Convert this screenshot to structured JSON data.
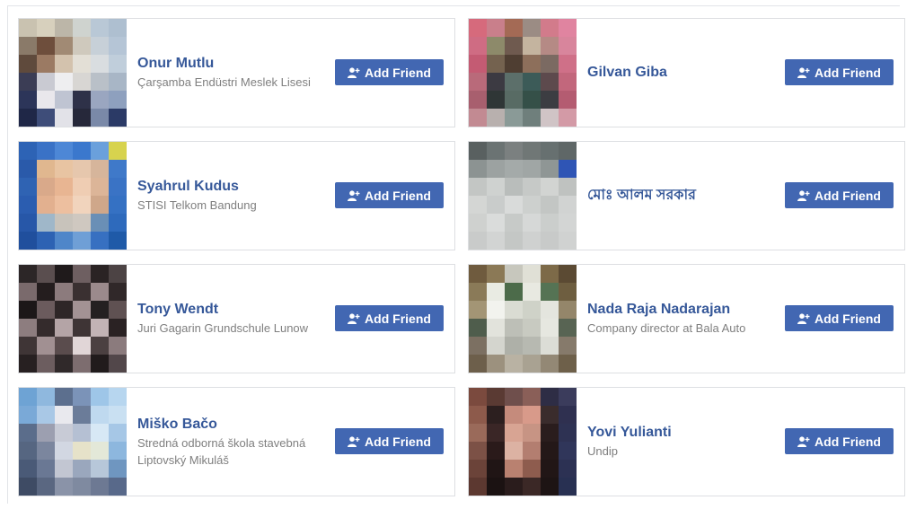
{
  "suggestions": [
    {
      "name": "Onur Mutlu",
      "subtitle": "Çarşamba Endüstri Meslek Lisesi",
      "button": "Add Friend",
      "icon": "add-friend-icon",
      "avatar_colors": [
        "#c9c2b0",
        "#d7d0bd",
        "#bcb6a8",
        "#cfd3cf",
        "#b9c8d6",
        "#aebfd0",
        "#8a7a69",
        "#6e4e3c",
        "#a18a74",
        "#cfc9bd",
        "#c7d0d8",
        "#b5c5d6",
        "#5f4a3c",
        "#9b7a63",
        "#d3c2ad",
        "#e3dfd6",
        "#d9dde0",
        "#c0cedb",
        "#3b3d55",
        "#c9cad2",
        "#eeeef0",
        "#d8d6d3",
        "#b9c0c8",
        "#a8b6c6",
        "#2c3559",
        "#e9e7ec",
        "#bfc4d2",
        "#2e3148",
        "#9aa6c0",
        "#8ea0be",
        "#1f2747",
        "#3e4d79",
        "#e2e2e8",
        "#26283a",
        "#7a89a8",
        "#2b3a66"
      ]
    },
    {
      "name": "Gilvan Giba",
      "subtitle": "",
      "button": "Add Friend",
      "icon": "add-friend-icon",
      "avatar_colors": [
        "#d66a7c",
        "#c97f8b",
        "#a46a55",
        "#9b8c84",
        "#d27b8b",
        "#e084a0",
        "#cf6c83",
        "#8d8a6a",
        "#6f5a4f",
        "#c4b49f",
        "#b58a85",
        "#d8859c",
        "#c45b73",
        "#74624f",
        "#4f3e32",
        "#8d6f5b",
        "#7b6a62",
        "#cf7088",
        "#b96a7a",
        "#3c3a42",
        "#5c6f6a",
        "#3c5b58",
        "#5d4a4d",
        "#c2677c",
        "#a85f6e",
        "#2f3636",
        "#586b64",
        "#355048",
        "#3c3d42",
        "#b45c71",
        "#c28a92",
        "#b8b0ae",
        "#8a9a97",
        "#6f7f7c",
        "#d0c4c6",
        "#d39aa6"
      ]
    },
    {
      "name": "Syahrul Kudus",
      "subtitle": "STISI Telkom Bandung",
      "button": "Add Friend",
      "icon": "add-friend-icon",
      "avatar_colors": [
        "#2d63b5",
        "#3a72c6",
        "#4d87d6",
        "#3b78cd",
        "#6aa0dc",
        "#d7d34e",
        "#2a5aaa",
        "#e0b78f",
        "#e8c4a2",
        "#e6c7ad",
        "#d6b59b",
        "#3f79c9",
        "#2f63b3",
        "#d9a98a",
        "#e8b592",
        "#efcdb3",
        "#dcb598",
        "#3a73c5",
        "#2b5db0",
        "#e2b08f",
        "#edbf9f",
        "#f1d4bd",
        "#cfa78a",
        "#3571c3",
        "#2757a8",
        "#9fb7c9",
        "#c8c3bb",
        "#cfc8c0",
        "#6a8fb6",
        "#2e6abc",
        "#204f9d",
        "#2d62b3",
        "#4f86c9",
        "#6f9fd6",
        "#3770c1",
        "#1f5aa8"
      ]
    },
    {
      "name": "মোঃ আলম সরকার",
      "subtitle": "",
      "button": "Add Friend",
      "icon": "add-friend-icon",
      "avatar_colors": [
        "#596060",
        "#6b7373",
        "#7b8080",
        "#707776",
        "#677070",
        "#5f6767",
        "#8c9392",
        "#9ca2a1",
        "#a4aaa9",
        "#a0a6a5",
        "#8f9695",
        "#2f55b5",
        "#c3c6c4",
        "#cfd2d0",
        "#b9bdbb",
        "#c6c9c7",
        "#d2d4d2",
        "#bfc2c0",
        "#d4d6d4",
        "#c9cccb",
        "#d9dbda",
        "#cdd0ce",
        "#c3c6c4",
        "#d1d3d2",
        "#cfd1cf",
        "#dadcdb",
        "#c7cac8",
        "#d6d8d7",
        "#cbcecc",
        "#d3d5d4",
        "#c9cbca",
        "#d2d4d3",
        "#c4c7c5",
        "#cfd1d0",
        "#c8cac9",
        "#d0d2d1"
      ]
    },
    {
      "name": "Tony Wendt",
      "subtitle": "Juri Gagarin Grundschule Lunow",
      "button": "Add Friend",
      "icon": "add-friend-icon",
      "avatar_colors": [
        "#2c2627",
        "#5a4e4f",
        "#1f1a1b",
        "#6e5f61",
        "#2a2324",
        "#4c4344",
        "#7a6a6c",
        "#241d1e",
        "#8c7b7d",
        "#3a3031",
        "#9b8a8c",
        "#302829",
        "#1c1718",
        "#6b5b5d",
        "#2e2627",
        "#a39294",
        "#242021",
        "#5f5152",
        "#8d7d7f",
        "#342b2c",
        "#b4a4a6",
        "#3e3435",
        "#c2b3b5",
        "#2a2223",
        "#3f3536",
        "#a19092",
        "#5a4c4d",
        "#e1d6d7",
        "#4b4041",
        "#8b7b7d",
        "#272021",
        "#6c5d5f",
        "#30292a",
        "#7d6d6f",
        "#211b1c",
        "#52474a"
      ]
    },
    {
      "name": "Nada Raja Nadarajan",
      "subtitle": "Company director at Bala Auto",
      "button": "Add Friend",
      "icon": "add-friend-icon",
      "avatar_colors": [
        "#6f5b3e",
        "#8b7956",
        "#c7c7bd",
        "#e0e0d6",
        "#7d6a48",
        "#5b4a33",
        "#8a7a58",
        "#e9ebe3",
        "#4c6b4a",
        "#e8e9e1",
        "#557354",
        "#6e5e40",
        "#a39575",
        "#f2f3ee",
        "#dadcd3",
        "#cfd2c8",
        "#e4e5de",
        "#94866a",
        "#4f5d4c",
        "#e2e3dc",
        "#bdbfb7",
        "#c8cac1",
        "#e6e7e0",
        "#586453",
        "#7c7062",
        "#d4d5ce",
        "#aeb0a8",
        "#b7b9b1",
        "#dcddd6",
        "#867a6b",
        "#6d5f4b",
        "#9c917e",
        "#b9b2a3",
        "#a9a292",
        "#938875",
        "#6e604a"
      ]
    },
    {
      "name": "Miško Bačo",
      "subtitle": "Stredná odborná škola stavebná Liptovský Mikuláš",
      "button": "Add Friend",
      "icon": "add-friend-icon",
      "avatar_colors": [
        "#6ea3d4",
        "#8fb8de",
        "#5c6f8e",
        "#7b93b8",
        "#9ec6e8",
        "#b7d6ef",
        "#7aa9d7",
        "#a9c8e6",
        "#e9e9ee",
        "#6b7c99",
        "#bfd9ef",
        "#c9e0f2",
        "#5b6d8b",
        "#9c9fb0",
        "#c8cbd6",
        "#b5c0d3",
        "#d7e8f5",
        "#a6c7e6",
        "#566681",
        "#7b869e",
        "#d2d7e2",
        "#e6e2c9",
        "#e3e8d8",
        "#8db7de",
        "#4a5a77",
        "#6a7894",
        "#c2c6d2",
        "#9aa7bd",
        "#b7c7d9",
        "#6f96c0",
        "#3e4b64",
        "#5a6781",
        "#8a93a8",
        "#7f8aa0",
        "#6d7993",
        "#58698a"
      ]
    },
    {
      "name": "Yovi Yulianti",
      "subtitle": "Undip",
      "button": "Add Friend",
      "icon": "add-friend-icon",
      "avatar_colors": [
        "#7b4a3e",
        "#5a3a33",
        "#6f4f4c",
        "#8a5f58",
        "#2e2d45",
        "#3b3c5c",
        "#8d5a4b",
        "#2c1f1f",
        "#c58b7c",
        "#d89a8a",
        "#3a2c2c",
        "#2f3050",
        "#9a6a5a",
        "#3a2626",
        "#d8a493",
        "#c79484",
        "#2a1d1d",
        "#2e3253",
        "#7c5146",
        "#2a1a1a",
        "#dcb2a3",
        "#b37e70",
        "#241818",
        "#30365a",
        "#6b4339",
        "#201515",
        "#b98170",
        "#8e5c4e",
        "#211616",
        "#2c3153",
        "#5c3830",
        "#1b1212",
        "#2a1c1c",
        "#3b2826",
        "#1d1414",
        "#283052"
      ]
    }
  ]
}
